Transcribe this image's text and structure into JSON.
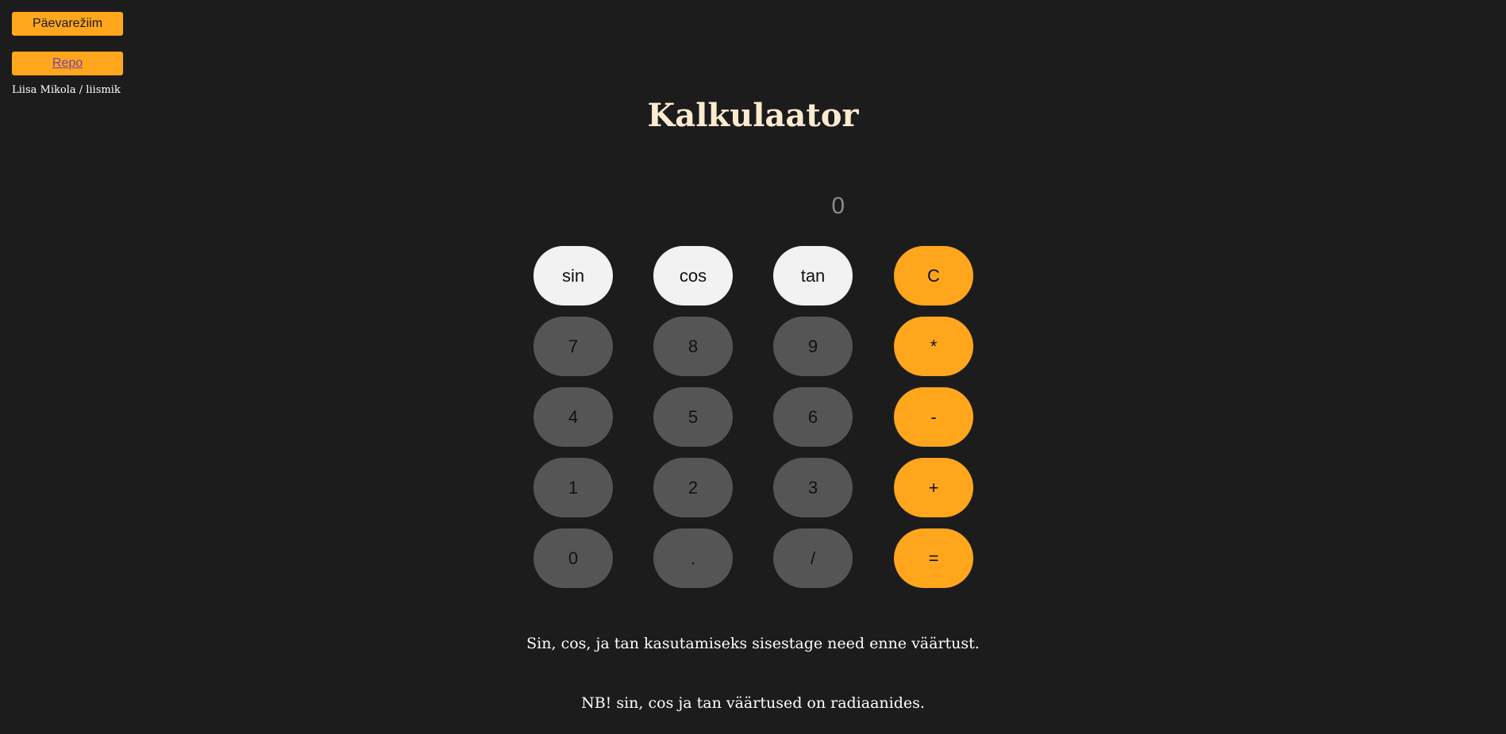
{
  "header": {
    "mode_button": "Päevarežiim",
    "repo_link": "Repo",
    "author": "Liisa Mikola / liismik"
  },
  "title": "Kalkulaator",
  "display": {
    "value": "0"
  },
  "keypad": {
    "rows": [
      [
        "sin",
        "cos",
        "tan",
        "C"
      ],
      [
        "7",
        "8",
        "9",
        "*"
      ],
      [
        "4",
        "5",
        "6",
        "-"
      ],
      [
        "1",
        "2",
        "3",
        "+"
      ],
      [
        "0",
        ".",
        "/",
        "="
      ]
    ],
    "colors": {
      "function": "#f2f2f2",
      "number": "#555555",
      "operator": "#ffa61d"
    }
  },
  "notes": [
    "Sin, cos, ja tan kasutamiseks sisestage need enne väärtust.",
    "NB! sin, cos ja tan väärtused on radiaanides."
  ],
  "colors": {
    "background": "#1c1c1c",
    "accent": "#ffa61d",
    "title": "#fdebd0"
  }
}
